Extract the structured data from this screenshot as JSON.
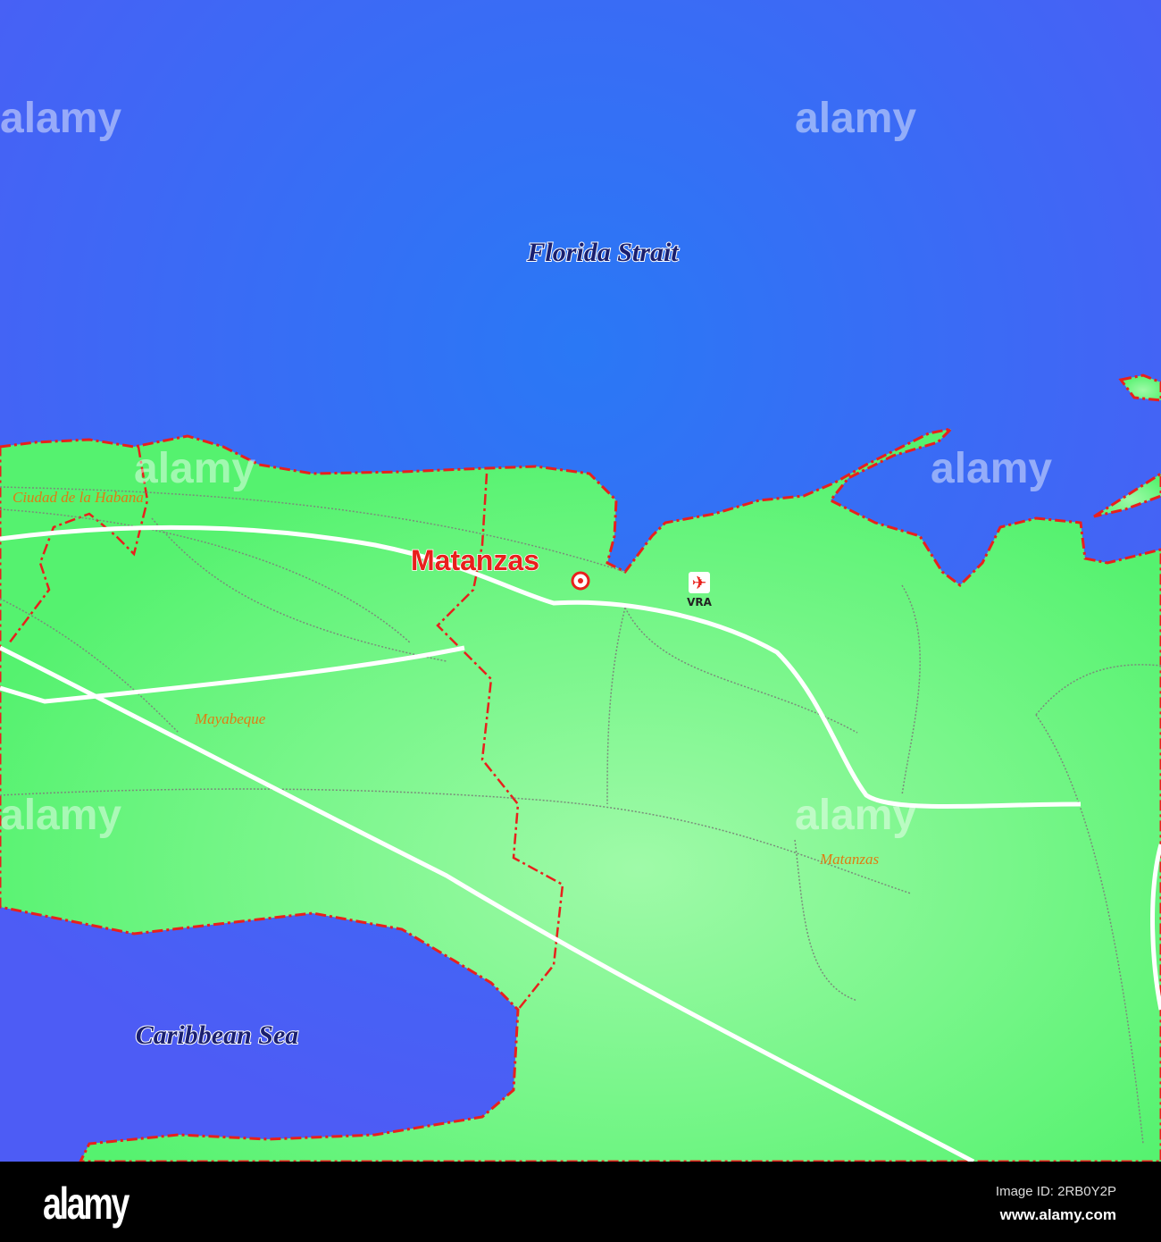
{
  "map": {
    "water_labels": [
      "Florida Strait",
      "Caribbean Sea"
    ],
    "city": {
      "name": "Matanzas"
    },
    "airport": {
      "code": "VRA",
      "icon": "airplane-icon"
    },
    "regions": [
      "Ciudad de la Habana",
      "Mayabeque",
      "Matanzas"
    ],
    "watermark": "alamy",
    "colors": {
      "sea": "#3f66f5",
      "land": "#5cf57a",
      "border": "#e8201c",
      "road": "#ffffff",
      "label": "#e07b12"
    }
  },
  "footer": {
    "logo": "alamy",
    "image_id": "Image ID: 2RB0Y2P",
    "site": "www.alamy.com"
  }
}
